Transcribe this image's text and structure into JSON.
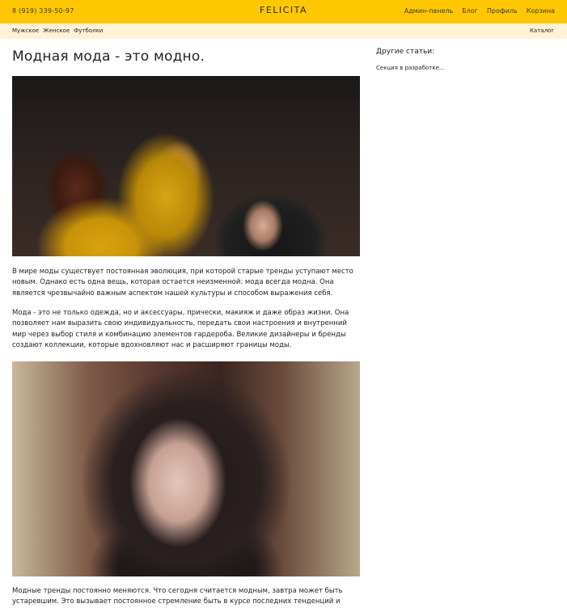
{
  "header": {
    "phone": "8 (919) 339-50-97",
    "logo": "FELICITA",
    "nav": {
      "admin": "Админ-панель",
      "blog": "Блог",
      "profile": "Профиль",
      "cart": "Корзина"
    }
  },
  "subnav": {
    "categories": [
      "Мужское",
      "Женское",
      "Футболки"
    ],
    "catalog": "Каталог"
  },
  "article": {
    "title": "Модная мода - это модно.",
    "paragraphs": [
      "В мире моды существует постоянная эволюция, при которой старые тренды уступают место новым. Однако есть одна вещь, которая остается неизменной: мода всегда модна. Она является чрезвычайно важным аспектом нашей культуры и способом выражения себя.",
      "Мода - это не только одежда, но и аксессуары, прически, макияж и даже образ жизни. Она позволяет нам выразить свою индивидуальность, передать свои настроения и внутренний мир через выбор стиля и комбинацию элементов гардероба. Великие дизайнеры и бренды создают коллекции, которые вдохновляют нас и расширяют границы моды.",
      "Модные тренды постоянно меняются. Что сегодня считается модным, завтра может быть устаревшим. Это вызывает постоянное стремление быть в курсе последних тенденций и"
    ]
  },
  "sidebar": {
    "title": "Другие статьи:",
    "text": "Секция в разработке..."
  },
  "colors": {
    "topbar": "#ffc700",
    "subbar": "#fff2d6"
  }
}
